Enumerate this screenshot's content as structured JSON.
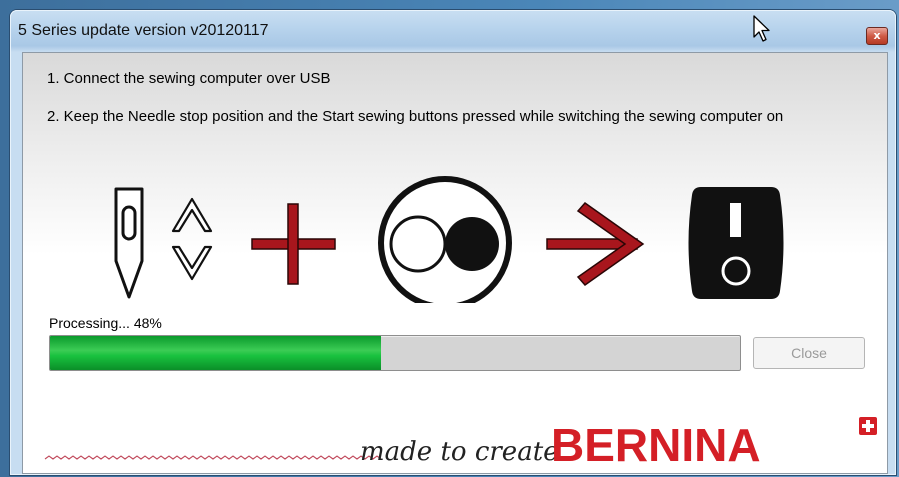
{
  "window": {
    "title": "5 Series update version v20120117",
    "close_glyph": "x"
  },
  "instructions": {
    "step1": "1. Connect the sewing computer over USB",
    "step2": "2. Keep the Needle stop position and the Start sewing buttons pressed while switching the sewing computer on"
  },
  "progress": {
    "label": "Processing... 48%",
    "value": 0.48
  },
  "buttons": {
    "close_label": "Close"
  },
  "branding": {
    "tagline": "made to create",
    "brand": "BERNINA",
    "brand_color": "#d41f26"
  },
  "icons": [
    "needle-icon",
    "up-chevron-icon",
    "down-chevron-icon",
    "plus-icon",
    "start-button-icon",
    "arrow-right-icon",
    "power-switch-icon",
    "stitch-pattern"
  ],
  "colors": {
    "accent_red": "#a8161d",
    "progress_green": "#19c23f"
  }
}
